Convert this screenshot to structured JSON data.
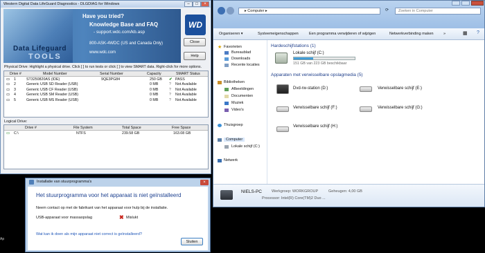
{
  "wd": {
    "title": "Western Digital Data LifeGuard Diagnostics - DLGDIAG for Windows",
    "logo_line1": "Data Lifeguard",
    "logo_line2": "TOOLS",
    "help_heading": "Have you tried?",
    "help_kb": "Knowledge Base and FAQ",
    "help_url": "- support.wdc.com/kb.asp",
    "help_phone": "800-ASK-4WDC (US and Canada Only)",
    "help_site": "www.wdc.com",
    "brand": "WD",
    "close_label": "Close",
    "help_label": "Help",
    "physical_hint": "Physical Drive:   Highlight a physical drive. Click [  ] to run tests or click [  ] to view SMART data. Right-click for more options.",
    "phys_headers": [
      "Drive #",
      "Model Number",
      "Serial Number",
      "Capacity",
      "SMART Status"
    ],
    "phys_rows": [
      {
        "num": "1",
        "model": "ST3250820AS (IDE)",
        "serial": "9QE3PG84",
        "cap": "250 GB",
        "status": "PASS",
        "ok": true
      },
      {
        "num": "2",
        "model": "Generic USB SD Reader (USB)",
        "serial": "",
        "cap": "0 MB",
        "status": "Not Available",
        "ok": false
      },
      {
        "num": "3",
        "model": "Generic USB CF Reader (USB)",
        "serial": "",
        "cap": "0 MB",
        "status": "Not Available",
        "ok": false
      },
      {
        "num": "4",
        "model": "Generic USB SM Reader (USB)",
        "serial": "",
        "cap": "0 MB",
        "status": "Not Available",
        "ok": false
      },
      {
        "num": "5",
        "model": "Generic USB MS Reader (USB)",
        "serial": "",
        "cap": "0 MB",
        "status": "Not Available",
        "ok": false
      }
    ],
    "logical_label": "Logical Drive:",
    "log_headers": [
      "Drive #",
      "File System",
      "Total Space",
      "Free Space"
    ],
    "log_rows": [
      {
        "drive": "C:\\",
        "fs": "NTFS",
        "total": "239.58 GB",
        "free": "163.08 GB"
      }
    ]
  },
  "explorer": {
    "breadcrumb": "▸ Computer ▸",
    "search_placeholder": "Zoeken in Computer",
    "toolbar": [
      "Organiseren ▾",
      "Systeemeigenschappen",
      "Een programma verwijderen of wijzigen",
      "Netwerkverbinding maken",
      "»"
    ],
    "nav": {
      "favorites": "Favorieten",
      "fav_items": [
        "Bureaublad",
        "Downloads",
        "Recente locaties"
      ],
      "libraries": "Bibliotheken",
      "lib_items": [
        "Afbeeldingen",
        "Documenten",
        "Muziek",
        "Video's"
      ],
      "homegroup": "Thuisgroep",
      "computer": "Computer",
      "computer_items": [
        "Lokale schijf (C:)"
      ],
      "network": "Netwerk"
    },
    "hdd_group": "Hardeschijfstations (1)",
    "hdd": {
      "name": "Lokale schijf (C:)",
      "free": "151 GB van 223 GB beschikbaar",
      "used_fraction": 0.32
    },
    "removable_group": "Apparaten met verwisselbare opslagmedia (5)",
    "removable": [
      "Dvd-rw-station (D:)",
      "Verwisselbare schijf (E:)",
      "Verwisselbare schijf (F:)",
      "Verwisselbare schijf (G:)",
      "Verwisselbare schijf (H:)"
    ],
    "details": {
      "pc": "NIELS-PC",
      "workgroup": "Werkgroep: WORKGROUP",
      "memory": "Geheugen: 4,00 GB",
      "processor": "Processor: Intel(R) Core(TM)2 Duo ..."
    }
  },
  "dialog": {
    "title": "Installatie van stuurprogramma's",
    "heading": "Het stuurprogramma voor het apparaat is niet geïnstalleerd",
    "body": "Neem contact op met de fabrikant van het apparaat voor hulp bij de installatie.",
    "device": "USB-apparaat voor massaopslag",
    "status": "Mislukt",
    "link": "Wat kan ik doen als mijn apparaat niet correct is geïnstalleerd?",
    "close_label": "Sluiten"
  },
  "desktop_fragment": "Ap"
}
